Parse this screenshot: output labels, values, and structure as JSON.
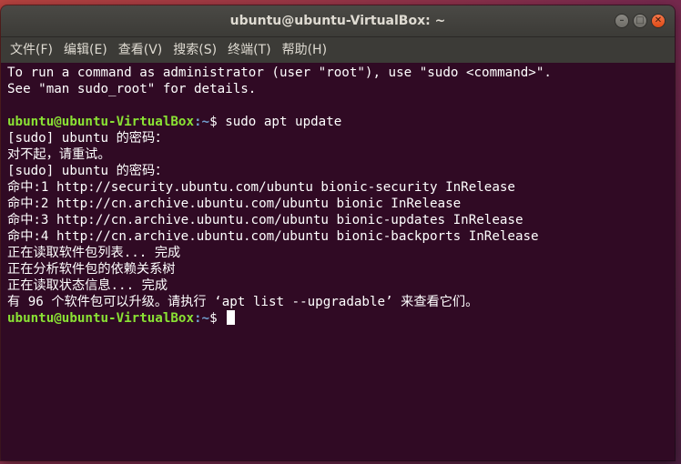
{
  "window": {
    "title": "ubuntu@ubuntu-VirtualBox: ~"
  },
  "controls": {
    "minimize_icon": "minimize-icon",
    "maximize_icon": "maximize-icon",
    "close_icon": "close-icon"
  },
  "menu": [
    {
      "label": "文件(F)"
    },
    {
      "label": "编辑(E)"
    },
    {
      "label": "查看(V)"
    },
    {
      "label": "搜索(S)"
    },
    {
      "label": "终端(T)"
    },
    {
      "label": "帮助(H)"
    }
  ],
  "terminal": {
    "colors": {
      "background": "#300a24",
      "text": "#ffffff",
      "prompt_user": "#8ae234",
      "prompt_path": "#729fcf"
    },
    "lines": [
      {
        "text": "To run a command as administrator (user \"root\"), use \"sudo <command>\"."
      },
      {
        "text": "See \"man sudo_root\" for details."
      },
      {
        "text": ""
      },
      {
        "prompt_user": "ubuntu@ubuntu-VirtualBox",
        "prompt_path": ":~",
        "prompt_symbol": "$ ",
        "command": "sudo apt update"
      },
      {
        "text": "[sudo] ubuntu 的密码："
      },
      {
        "text": "对不起，请重试。"
      },
      {
        "text": "[sudo] ubuntu 的密码："
      },
      {
        "text": "命中:1 http://security.ubuntu.com/ubuntu bionic-security InRelease"
      },
      {
        "text": "命中:2 http://cn.archive.ubuntu.com/ubuntu bionic InRelease"
      },
      {
        "text": "命中:3 http://cn.archive.ubuntu.com/ubuntu bionic-updates InRelease"
      },
      {
        "text": "命中:4 http://cn.archive.ubuntu.com/ubuntu bionic-backports InRelease"
      },
      {
        "text": "正在读取软件包列表... 完成"
      },
      {
        "text": "正在分析软件包的依赖关系树"
      },
      {
        "text": "正在读取状态信息... 完成"
      },
      {
        "text": "有 96 个软件包可以升级。请执行 ‘apt list --upgradable’ 来查看它们。"
      },
      {
        "prompt_user": "ubuntu@ubuntu-VirtualBox",
        "prompt_path": ":~",
        "prompt_symbol": "$ ",
        "command": "",
        "cursor": true
      }
    ]
  }
}
